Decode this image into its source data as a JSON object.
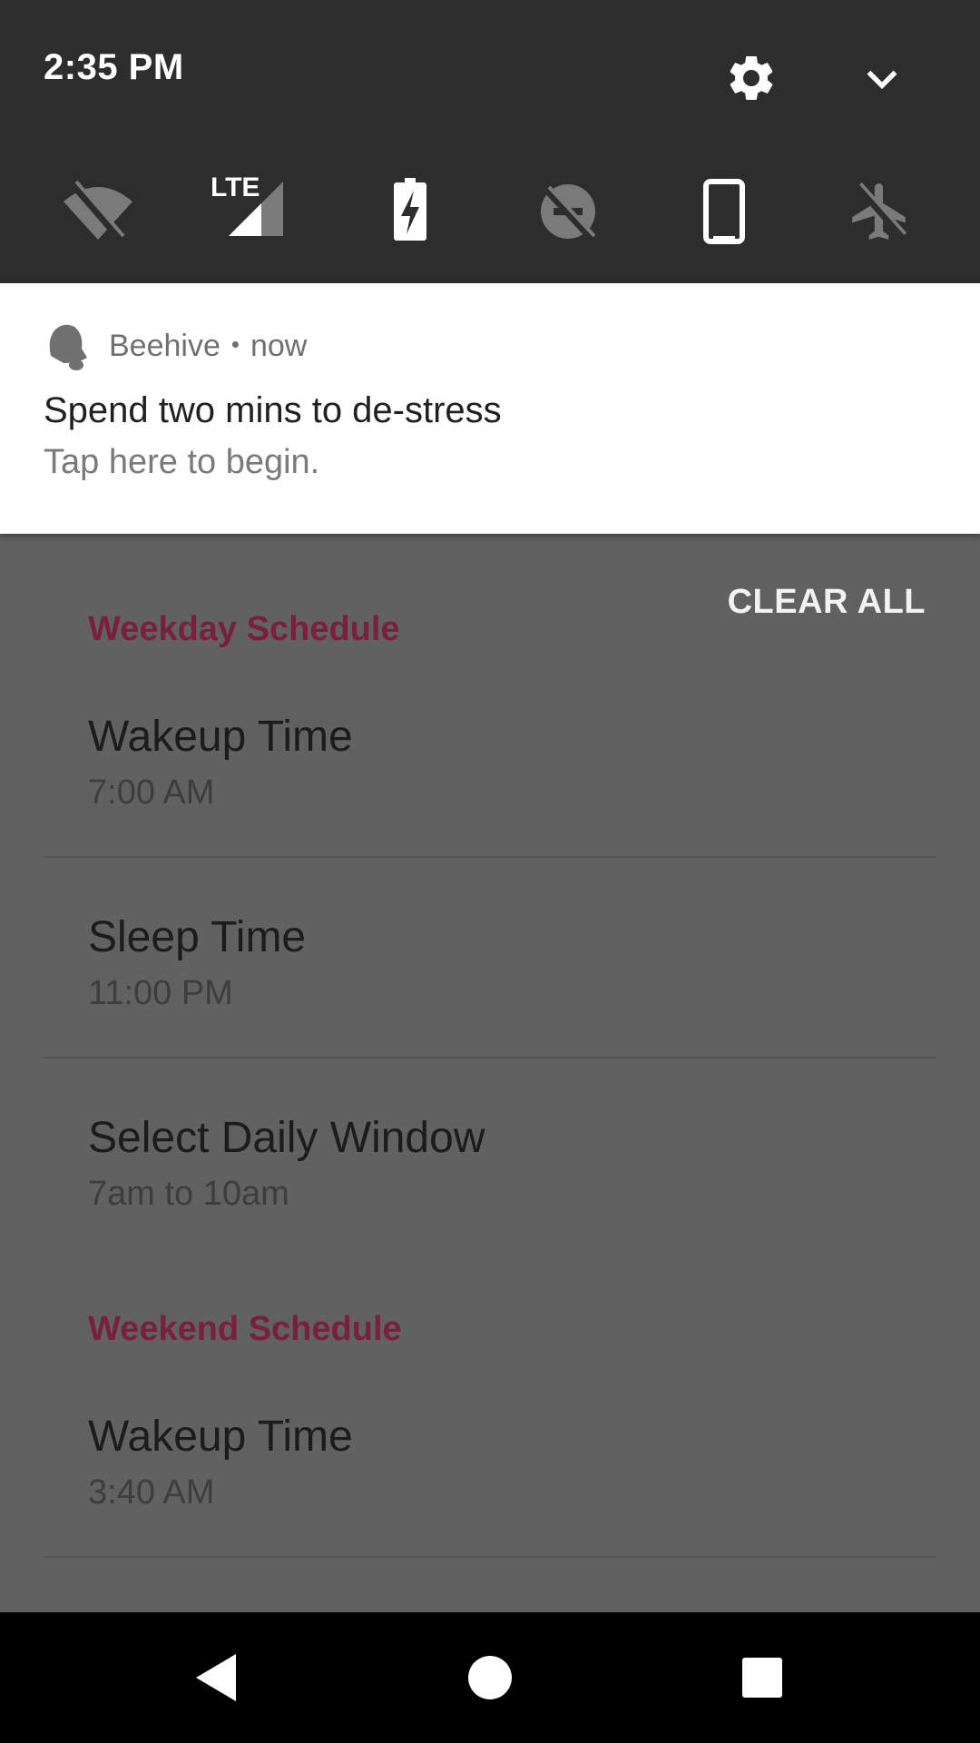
{
  "status": {
    "time": "2:35 PM"
  },
  "quick_settings": {
    "lte_label": "LTE",
    "tiles": [
      "wifi-off-icon",
      "lte-signal-icon",
      "battery-saver-icon",
      "dnd-off-icon",
      "auto-rotate-icon",
      "airplane-mode-icon"
    ]
  },
  "notification": {
    "app": "Beehive",
    "separator": "•",
    "when": "now",
    "title": "Spend two mins to de-stress",
    "text": "Tap here to begin."
  },
  "content": {
    "clear_all": "CLEAR ALL",
    "weekday": {
      "header": "Weekday Schedule",
      "items": [
        {
          "title": "Wakeup Time",
          "value": "7:00 AM"
        },
        {
          "title": "Sleep Time",
          "value": "11:00 PM"
        },
        {
          "title": "Select Daily Window",
          "value": "7am to 10am"
        }
      ]
    },
    "weekend": {
      "header": "Weekend Schedule",
      "items": [
        {
          "title": "Wakeup Time",
          "value": "3:40 AM"
        }
      ]
    }
  },
  "colors": {
    "section_accent": "#7a1f3d",
    "shade_bg": "#2d2d2d",
    "scrim_bg": "#616161"
  }
}
